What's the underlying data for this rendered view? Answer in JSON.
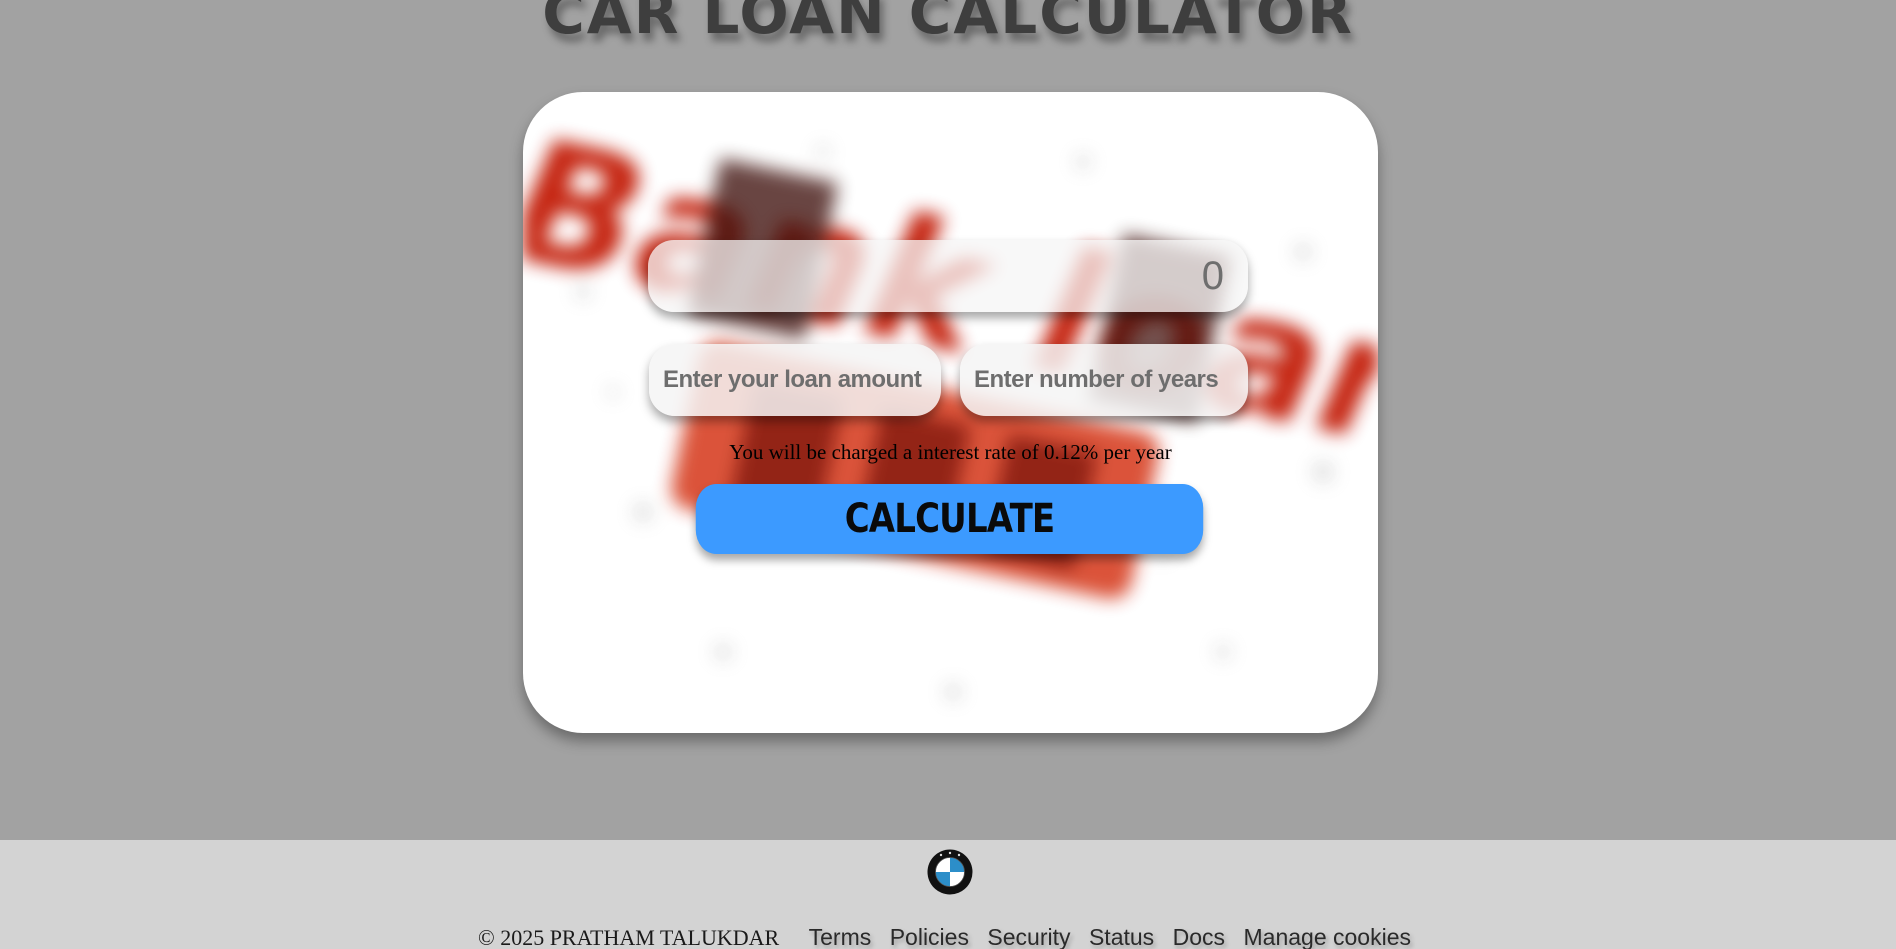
{
  "page": {
    "title": "CAR LOAN CALCULATOR"
  },
  "calculator": {
    "result_value": "0",
    "loan_amount_placeholder": "Enter your loan amount",
    "years_placeholder": "Enter number of years",
    "rate_text": "You will be charged a interest rate of 0.12% per year",
    "calculate_label": "CALCULATE",
    "background_image_text": "Bank loan"
  },
  "footer": {
    "logo": "bmw-logo-icon",
    "copyright": "© 2025 PRATHAM TALUKDAR",
    "links": [
      "Terms",
      "Policies",
      "Security",
      "Status",
      "Docs",
      "Manage cookies"
    ]
  },
  "colors": {
    "page_background": "#a2a2a2",
    "card_background": "#ffffff",
    "button_accent": "#3c9aff",
    "footer_background": "#d3d3d3"
  }
}
